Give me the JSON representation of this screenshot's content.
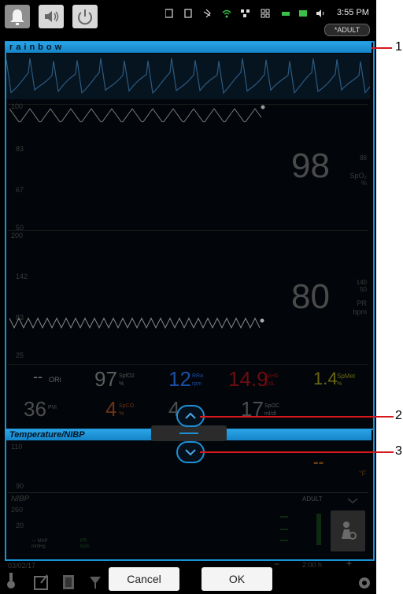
{
  "status_bar": {
    "time": "3:55 PM",
    "patient_mode": "*ADULT"
  },
  "rainbow_panel": {
    "title": "rainbow",
    "spo2": {
      "scale_top": "100",
      "scale_1": "83",
      "scale_2": "67",
      "scale_bottom": "50",
      "value": "98",
      "alarm": "88",
      "label": "SpO₂",
      "unit": "%"
    },
    "pr": {
      "scale_top": "200",
      "scale_1": "142",
      "scale_2": "83",
      "scale_bottom": "25",
      "value": "80",
      "alarm_high": "140",
      "alarm_low": "50",
      "label": "PR",
      "unit": "bpm"
    },
    "params": {
      "ori": {
        "value": "--",
        "label": "ORi"
      },
      "spfo2": {
        "value": "97",
        "label": "SpfO2",
        "unit": "%"
      },
      "rra": {
        "value": "12",
        "label": "RRa",
        "unit": "rpm"
      },
      "sphb": {
        "value": "14.9",
        "label": "SpHb",
        "unit": "g/dL"
      },
      "spmet": {
        "value": "1.4",
        "label": "SpMet",
        "unit": "%"
      },
      "pvi": {
        "value": "36",
        "label": "PVi"
      },
      "spco": {
        "value": "4",
        "label": "SpCO",
        "unit": "%"
      },
      "pi": {
        "value": "4"
      },
      "spoc": {
        "value": "17",
        "label": "SpOC",
        "unit": "ml/dl"
      }
    }
  },
  "temp_panel": {
    "title": "Temperature/NIBP",
    "temp_scale_top": "110",
    "temp_scale_bottom": "90",
    "temp_value": "--",
    "temp_unit": "°F",
    "nibp_label": "NIBP",
    "nibp_mode": "ADULT",
    "nibp_scale_top": "260",
    "nibp_scale_bottom": "20",
    "map_label": "MAP",
    "map_unit": "mmHg",
    "pr_label": "PR",
    "pr_unit": "bpm"
  },
  "footer": {
    "date": "03/02/17",
    "interval": "2:00 h",
    "minus": "−",
    "plus": "+"
  },
  "actions": {
    "cancel": "Cancel",
    "ok": "OK"
  },
  "callouts": [
    "1",
    "2",
    "3"
  ]
}
